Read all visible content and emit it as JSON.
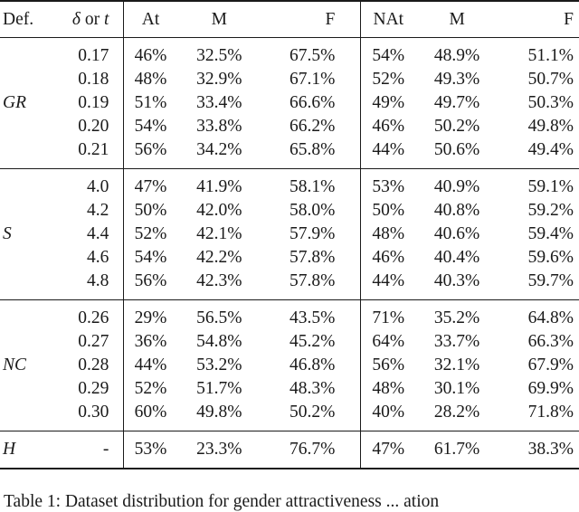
{
  "table": {
    "headers": {
      "def": "Def.",
      "param": "δ or t",
      "at": "At",
      "at_m": "M",
      "at_f": "F",
      "nat": "NAt",
      "nat_m": "M",
      "nat_f": "F"
    },
    "groups": [
      {
        "name": "GR",
        "rows": [
          {
            "param": "0.17",
            "at": "46%",
            "at_m": "32.5%",
            "at_f": "67.5%",
            "nat": "54%",
            "nat_m": "48.9%",
            "nat_f": "51.1%"
          },
          {
            "param": "0.18",
            "at": "48%",
            "at_m": "32.9%",
            "at_f": "67.1%",
            "nat": "52%",
            "nat_m": "49.3%",
            "nat_f": "50.7%"
          },
          {
            "param": "0.19",
            "at": "51%",
            "at_m": "33.4%",
            "at_f": "66.6%",
            "nat": "49%",
            "nat_m": "49.7%",
            "nat_f": "50.3%"
          },
          {
            "param": "0.20",
            "at": "54%",
            "at_m": "33.8%",
            "at_f": "66.2%",
            "nat": "46%",
            "nat_m": "50.2%",
            "nat_f": "49.8%"
          },
          {
            "param": "0.21",
            "at": "56%",
            "at_m": "34.2%",
            "at_f": "65.8%",
            "nat": "44%",
            "nat_m": "50.6%",
            "nat_f": "49.4%"
          }
        ]
      },
      {
        "name": "S",
        "rows": [
          {
            "param": "4.0",
            "at": "47%",
            "at_m": "41.9%",
            "at_f": "58.1%",
            "nat": "53%",
            "nat_m": "40.9%",
            "nat_f": "59.1%"
          },
          {
            "param": "4.2",
            "at": "50%",
            "at_m": "42.0%",
            "at_f": "58.0%",
            "nat": "50%",
            "nat_m": "40.8%",
            "nat_f": "59.2%"
          },
          {
            "param": "4.4",
            "at": "52%",
            "at_m": "42.1%",
            "at_f": "57.9%",
            "nat": "48%",
            "nat_m": "40.6%",
            "nat_f": "59.4%"
          },
          {
            "param": "4.6",
            "at": "54%",
            "at_m": "42.2%",
            "at_f": "57.8%",
            "nat": "46%",
            "nat_m": "40.4%",
            "nat_f": "59.6%"
          },
          {
            "param": "4.8",
            "at": "56%",
            "at_m": "42.3%",
            "at_f": "57.8%",
            "nat": "44%",
            "nat_m": "40.3%",
            "nat_f": "59.7%"
          }
        ]
      },
      {
        "name": "NC",
        "rows": [
          {
            "param": "0.26",
            "at": "29%",
            "at_m": "56.5%",
            "at_f": "43.5%",
            "nat": "71%",
            "nat_m": "35.2%",
            "nat_f": "64.8%"
          },
          {
            "param": "0.27",
            "at": "36%",
            "at_m": "54.8%",
            "at_f": "45.2%",
            "nat": "64%",
            "nat_m": "33.7%",
            "nat_f": "66.3%"
          },
          {
            "param": "0.28",
            "at": "44%",
            "at_m": "53.2%",
            "at_f": "46.8%",
            "nat": "56%",
            "nat_m": "32.1%",
            "nat_f": "67.9%"
          },
          {
            "param": "0.29",
            "at": "52%",
            "at_m": "51.7%",
            "at_f": "48.3%",
            "nat": "48%",
            "nat_m": "30.1%",
            "nat_f": "69.9%"
          },
          {
            "param": "0.30",
            "at": "60%",
            "at_m": "49.8%",
            "at_f": "50.2%",
            "nat": "40%",
            "nat_m": "28.2%",
            "nat_f": "71.8%"
          }
        ]
      },
      {
        "name": "H",
        "rows": [
          {
            "param": "-",
            "at": "53%",
            "at_m": "23.3%",
            "at_f": "76.7%",
            "nat": "47%",
            "nat_m": "61.7%",
            "nat_f": "38.3%"
          }
        ]
      }
    ]
  },
  "caption": "Table 1: Dataset distribution for gender attractiveness ... ation"
}
